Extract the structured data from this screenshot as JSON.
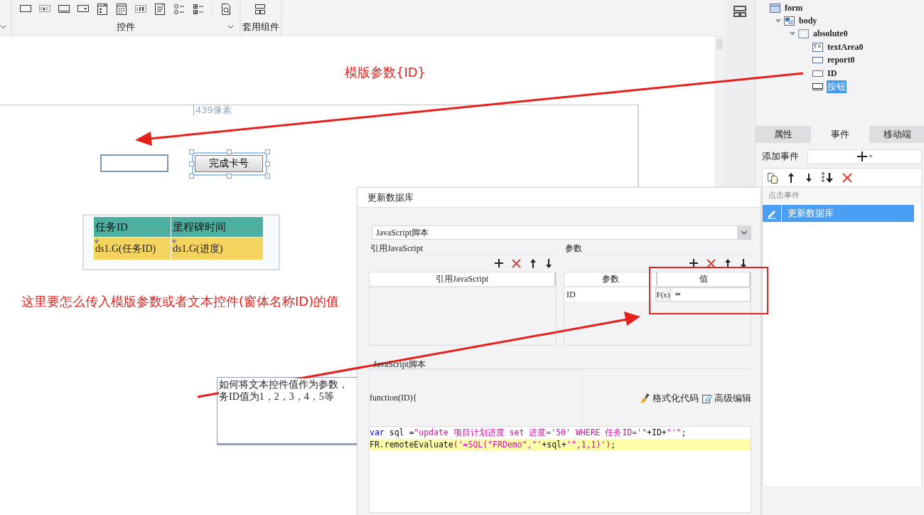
{
  "ribbon": {
    "groups": [
      {
        "label": "控件",
        "collapsible": true
      },
      {
        "label": "套用组件",
        "collapsible": false
      }
    ]
  },
  "canvas": {
    "width_hint": "439像素",
    "button": {
      "label": "完成卡号",
      "selected": true
    },
    "report": {
      "columns": [
        "任务ID",
        "里程碑时间"
      ],
      "cells": [
        "ds1.G(任务ID)",
        "ds1.G(进度)"
      ]
    },
    "text_area": {
      "lines": [
        "如何将文本控件值作为参数，",
        "务ID值为1，2，3，4，5等"
      ]
    }
  },
  "annotations": [
    {
      "text": "模版参数{ID}"
    },
    {
      "text": "这里要怎么传入模版参数或者文本控件(窗体名称ID)的值"
    }
  ],
  "widget_tree": [
    {
      "label": "form",
      "kind": "form",
      "selected": false,
      "children": [
        {
          "label": "body",
          "kind": "body",
          "selected": false,
          "children": [
            {
              "label": "absolute0",
              "kind": "layout",
              "selected": false,
              "children": [
                {
                  "label": "textArea0",
                  "kind": "textarea",
                  "selected": false
                },
                {
                  "label": "report0",
                  "kind": "report",
                  "selected": false
                },
                {
                  "label": "ID",
                  "kind": "textfield",
                  "selected": false
                },
                {
                  "label": "按钮",
                  "kind": "button",
                  "selected": true
                }
              ]
            }
          ]
        }
      ]
    }
  ],
  "side_tabs": [
    {
      "label": "属性",
      "selected": false
    },
    {
      "label": "事件",
      "selected": true
    },
    {
      "label": "移动端",
      "selected": false
    }
  ],
  "events": {
    "add_label": "添加事件",
    "group": "点击事件",
    "items": [
      {
        "label": "更新数据库",
        "selected": true
      }
    ]
  },
  "dialog": {
    "title": "更新数据库",
    "type_select": "JavaScript脚本",
    "js_section": {
      "title": "引用JavaScript",
      "columns": [
        "引用JavaScript"
      ]
    },
    "params_section": {
      "title": "参数",
      "columns": [
        "参数",
        "值"
      ],
      "rows": [
        {
          "name": "ID",
          "formula_button": "F(x)",
          "value": "="
        }
      ]
    },
    "script_label": "JavaScript脚本",
    "signature": "function(ID){",
    "actions": [
      {
        "label": "格式化代码",
        "kind": "format"
      },
      {
        "label": "高级编辑",
        "kind": "edit"
      }
    ],
    "code": [
      {
        "highlighted": false,
        "tokens": [
          {
            "kind": "keyword",
            "text": "var"
          },
          {
            "kind": "plain",
            "text": " sql ="
          },
          {
            "kind": "string",
            "text": "\"update 项目计划进度 set 进度='50' WHERE 任务ID='\""
          },
          {
            "kind": "plain",
            "text": "+ID+"
          },
          {
            "kind": "string",
            "text": "\"'\""
          },
          {
            "kind": "plain",
            "text": ";"
          }
        ]
      },
      {
        "highlighted": true,
        "tokens": [
          {
            "kind": "plain",
            "text": "FR.remoteEvaluate"
          },
          {
            "kind": "paren",
            "text": "("
          },
          {
            "kind": "string",
            "text": "'=SQL(\"FRDemo\",\"'"
          },
          {
            "kind": "plain",
            "text": "+sql+"
          },
          {
            "kind": "string",
            "text": "'\",1,1)'"
          },
          {
            "kind": "paren",
            "text": ")"
          },
          {
            "kind": "plain",
            "text": ";"
          }
        ]
      }
    ]
  }
}
